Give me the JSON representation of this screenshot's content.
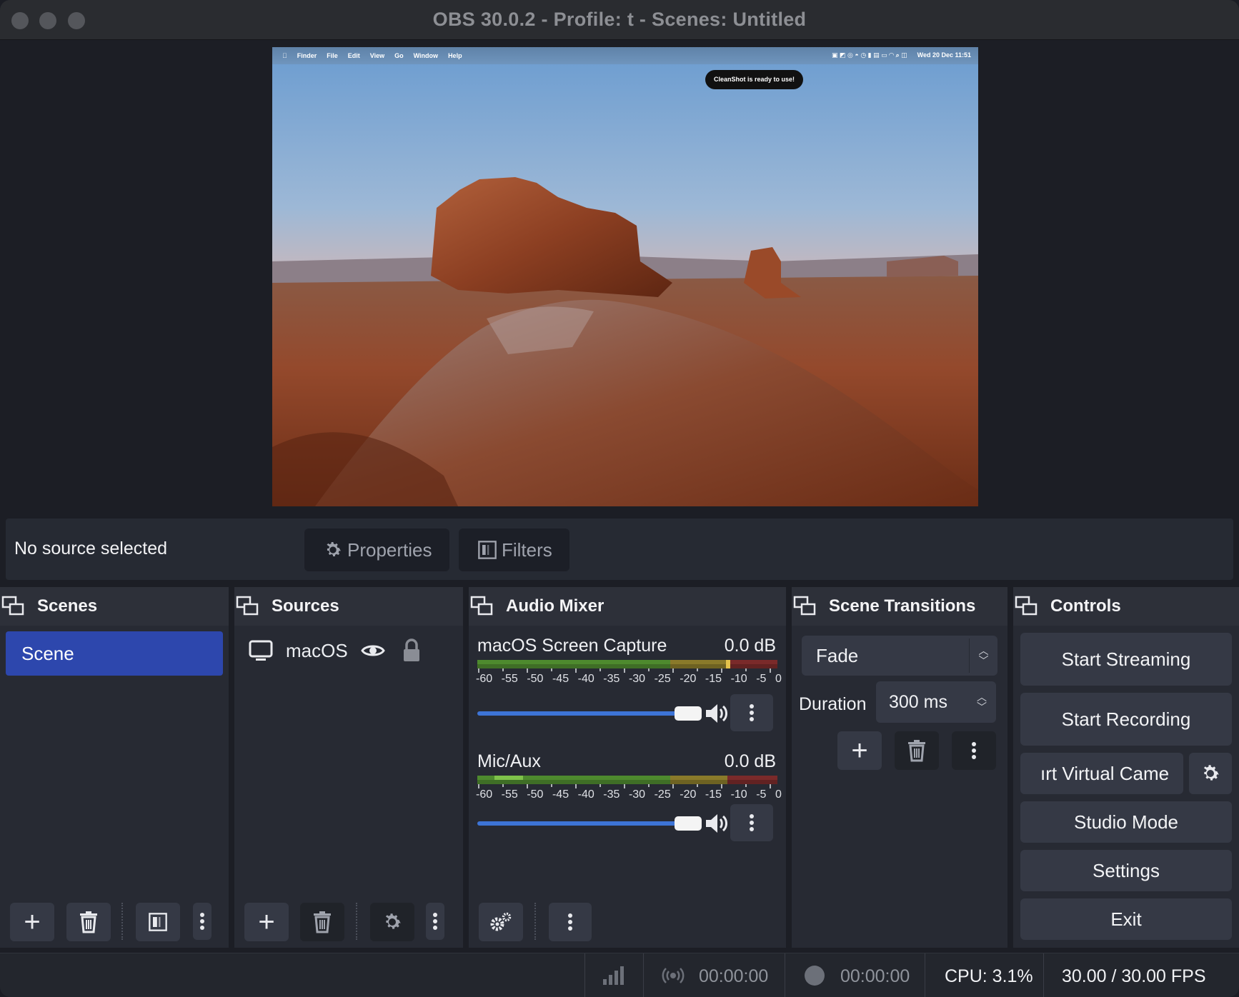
{
  "window": {
    "title": "OBS 30.0.2 - Profile: t - Scenes: Untitled"
  },
  "preview": {
    "menubar": {
      "items": [
        "Finder",
        "File",
        "Edit",
        "View",
        "Go",
        "Window",
        "Help"
      ],
      "clock": "Wed 20 Dec  11:51"
    },
    "toast": "CleanShot is ready to use!"
  },
  "source_bar": {
    "status": "No source selected",
    "properties_label": "Properties",
    "filters_label": "Filters"
  },
  "scenes": {
    "title": "Scenes",
    "items": [
      "Scene"
    ],
    "selected": "Scene"
  },
  "sources": {
    "title": "Sources",
    "items": [
      {
        "label": "macOS",
        "type": "display-capture",
        "visible": true,
        "locked": false
      }
    ]
  },
  "mixer": {
    "title": "Audio Mixer",
    "channels": [
      {
        "name": "macOS Screen Capture",
        "level": "0.0 dB",
        "volume_pct": 100
      },
      {
        "name": "Mic/Aux",
        "level": "0.0 dB",
        "volume_pct": 100
      }
    ],
    "tick_labels": [
      "-60",
      "-55",
      "-50",
      "-45",
      "-40",
      "-35",
      "-30",
      "-25",
      "-20",
      "-15",
      "-10",
      "-5",
      "0"
    ]
  },
  "transitions": {
    "title": "Scene Transitions",
    "selected": "Fade",
    "duration_label": "Duration",
    "duration_value": "300 ms"
  },
  "controls": {
    "title": "Controls",
    "start_streaming": "Start Streaming",
    "start_recording": "Start Recording",
    "virtual_camera": "ırt Virtual Came",
    "studio_mode": "Studio Mode",
    "settings": "Settings",
    "exit": "Exit"
  },
  "status": {
    "stream_time": "00:00:00",
    "record_time": "00:00:00",
    "cpu": "CPU: 3.1%",
    "fps": "30.00 / 30.00 FPS"
  },
  "colors": {
    "accent": "#2d47ad",
    "volume": "#3d74d6",
    "panel": "#272a33",
    "background": "#1c1e25"
  }
}
